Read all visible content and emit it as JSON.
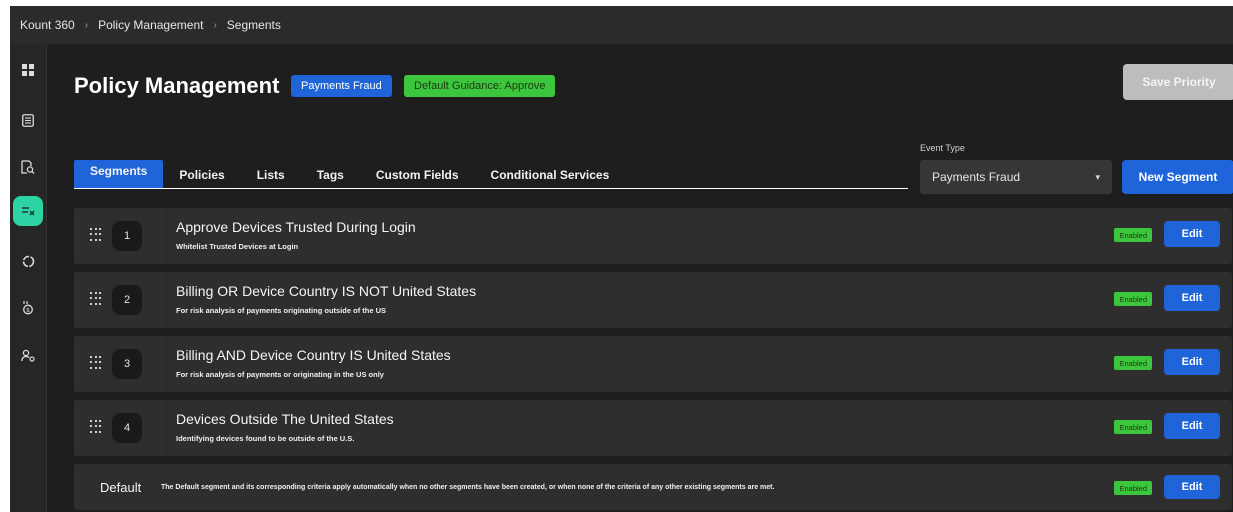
{
  "breadcrumb": [
    "Kount 360",
    "Policy Management",
    "Segments"
  ],
  "breadcrumb_separator": "›",
  "sidebar": {
    "icons": [
      "dashboard-icon",
      "list-icon",
      "search-document-icon",
      "policy-icon",
      "circle-icon",
      "money-person-icon",
      "users-gear-icon"
    ],
    "active_index": 3,
    "active_color": "#2ed3a4"
  },
  "header": {
    "title": "Policy Management",
    "badge_payments": "Payments Fraud",
    "badge_guidance": "Default Guidance: Approve",
    "save_label": "Save Priority"
  },
  "tabs": [
    {
      "label": "Segments",
      "active": true
    },
    {
      "label": "Policies",
      "active": false
    },
    {
      "label": "Lists",
      "active": false
    },
    {
      "label": "Tags",
      "active": false
    },
    {
      "label": "Custom Fields",
      "active": false
    },
    {
      "label": "Conditional Services",
      "active": false
    }
  ],
  "event_type": {
    "label": "Event Type",
    "value": "Payments Fraud",
    "caret": "▾"
  },
  "new_segment_label": "New Segment",
  "segments": [
    {
      "number": "1",
      "title": "Approve Devices Trusted During Login",
      "description": "Whitelist Trusted Devices at Login",
      "status": "Enabled",
      "edit": "Edit"
    },
    {
      "number": "2",
      "title": "Billing OR Device Country IS NOT United States",
      "description": "For risk analysis of payments originating outside of the US",
      "status": "Enabled",
      "edit": "Edit"
    },
    {
      "number": "3",
      "title": "Billing AND Device Country IS United States",
      "description": "For risk analysis of payments or originating in the US only",
      "status": "Enabled",
      "edit": "Edit"
    },
    {
      "number": "4",
      "title": "Devices Outside The United States",
      "description": "Identifying devices found to be outside of the U.S.",
      "status": "Enabled",
      "edit": "Edit"
    }
  ],
  "default_segment": {
    "label": "Default",
    "description": "The Default segment and its corresponding criteria apply automatically when no other segments have been created, or when none of the criteria of any other existing segments are met.",
    "status": "Enabled",
    "edit": "Edit"
  },
  "colors": {
    "accent_blue": "#1f64d8",
    "enabled_green": "#3cc63e",
    "background": "#1e1e1e",
    "row": "#2e2e2e"
  }
}
